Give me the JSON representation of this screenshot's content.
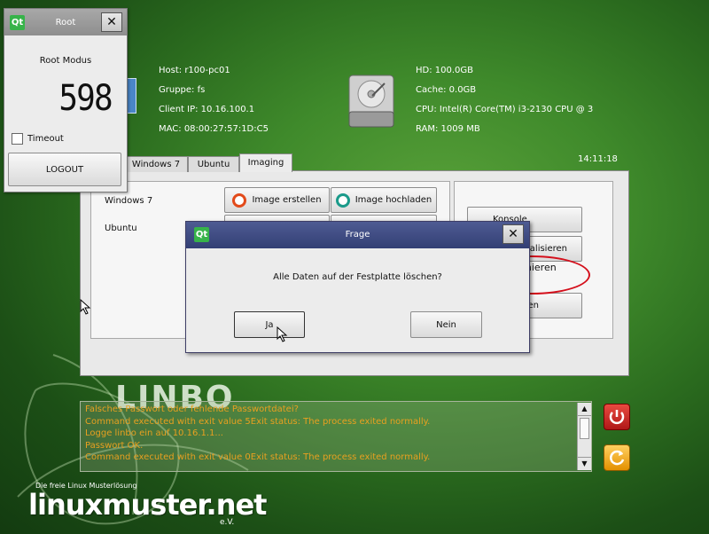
{
  "root_window": {
    "title": "Root",
    "heading": "Root Modus",
    "counter": "598",
    "timeout_label": "Timeout",
    "timeout_checked": false,
    "logout_label": "LOGOUT"
  },
  "host_info": {
    "host": "Host: r100-pc01",
    "group": "Gruppe: fs",
    "client_ip": "Client IP: 10.16.100.1",
    "mac": "MAC: 08:00:27:57:1D:C5"
  },
  "hw_info": {
    "hd": "HD: 100.0GB",
    "cache": "Cache: 0.0GB",
    "cpu": "CPU: Intel(R) Core(TM) i3-2130 CPU @ 3",
    "ram": "RAM: 1009 MB"
  },
  "clock": "14:11:18",
  "tabs": [
    {
      "label": "Windows 7",
      "active": false
    },
    {
      "label": "Ubuntu",
      "active": false
    },
    {
      "label": "Imaging",
      "active": true
    }
  ],
  "imaging": {
    "os_rows": [
      {
        "label": "Windows 7"
      },
      {
        "label": "Ubuntu"
      }
    ],
    "create_image_label": "Image erstellen",
    "upload_image_label": "Image hochladen",
    "right_buttons": {
      "konsole_partial": "Konsole",
      "aktualisieren_partial": "tualisieren",
      "partitionieren_partial": "ren"
    },
    "annotation": "Partitionieren"
  },
  "dialog": {
    "title": "Frage",
    "message": "Alle Daten auf der Festplatte löschen?",
    "yes_label": "Ja",
    "no_label": "Nein"
  },
  "log": {
    "lines": [
      {
        "text": "Falsches Passwort oder fehlende Passwortdatei?",
        "color": "#e8a020"
      },
      {
        "text": "Command executed with exit value 5Exit status: The process exited normally.",
        "color": "#e8a020"
      },
      {
        "text": "Logge linbo ein auf 10.16.1.1...",
        "color": "#e8a020"
      },
      {
        "text": "Passwort OK.",
        "color": "#e8a020"
      },
      {
        "text": "Command executed with exit value 0Exit status: The process exited normally.",
        "color": "#e8a020"
      }
    ]
  },
  "branding": {
    "linbo": "LINBO",
    "tagline": "Die freie Linux Musterlösung",
    "logo": "linuxmuster.net",
    "ev": "e.V."
  },
  "colors": {
    "accent_dialog": "#3a4680",
    "annotation": "#d4101c",
    "power_button": "#d42020",
    "refresh_button": "#f0a010"
  }
}
